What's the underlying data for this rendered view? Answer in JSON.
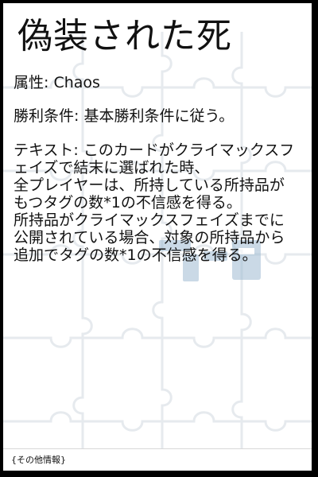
{
  "card": {
    "title": "偽装された死",
    "attribute": "属性: Chaos",
    "victory": "勝利条件: 基本勝利条件に従う。",
    "text_lines": [
      "テキスト: このカードがクライマックスフ",
      "ェイズで結末に選ばれた時、",
      "全プレイヤーは、所持している所持品が",
      "もつタグの数*1の不信感を得る。",
      "所持品がクライマックスフェイズまでに",
      "公開されている場合、対象の所持品から",
      "追加でタグの数*1の不信感を得る。"
    ]
  },
  "footer": {
    "label": "{その他情報}"
  },
  "colors": {
    "frame": "#000000",
    "card_background": "#ffffff",
    "puzzle_lines": "#e4e8ec",
    "watermark": "#7fa7c6"
  }
}
